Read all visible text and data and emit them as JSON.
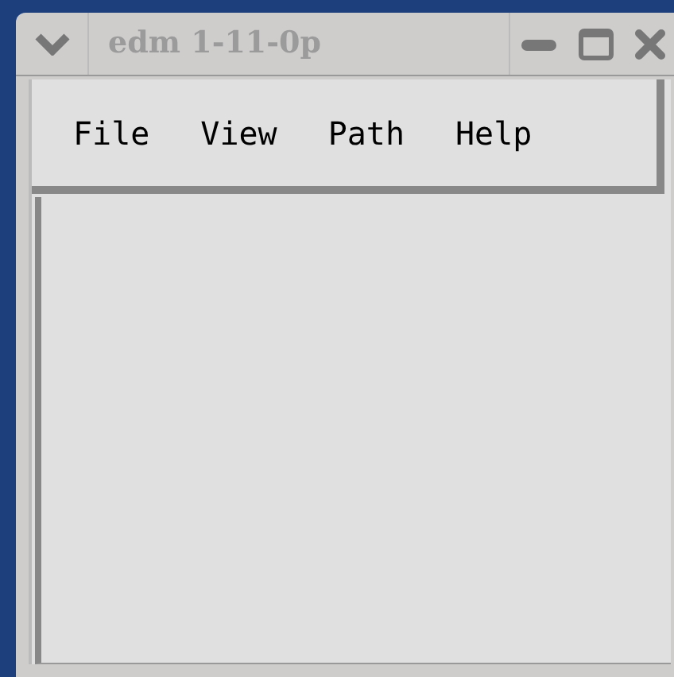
{
  "window": {
    "title": "edm 1-11-0p"
  },
  "menu": [
    {
      "label": "File"
    },
    {
      "label": "View"
    },
    {
      "label": "Path"
    },
    {
      "label": "Help"
    }
  ]
}
